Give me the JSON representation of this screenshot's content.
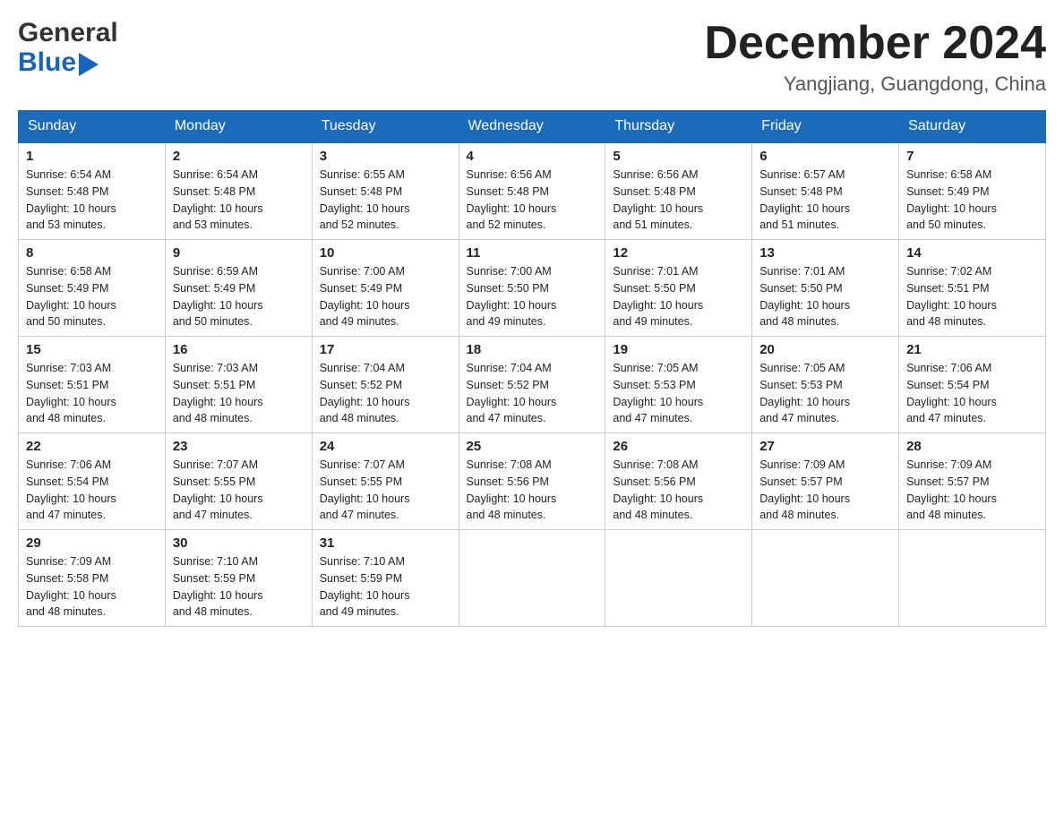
{
  "header": {
    "logo_general": "General",
    "logo_blue": "Blue",
    "month_title": "December 2024",
    "location": "Yangjiang, Guangdong, China"
  },
  "days_of_week": [
    "Sunday",
    "Monday",
    "Tuesday",
    "Wednesday",
    "Thursday",
    "Friday",
    "Saturday"
  ],
  "weeks": [
    [
      {
        "num": "1",
        "info": "Sunrise: 6:54 AM\nSunset: 5:48 PM\nDaylight: 10 hours\nand 53 minutes."
      },
      {
        "num": "2",
        "info": "Sunrise: 6:54 AM\nSunset: 5:48 PM\nDaylight: 10 hours\nand 53 minutes."
      },
      {
        "num": "3",
        "info": "Sunrise: 6:55 AM\nSunset: 5:48 PM\nDaylight: 10 hours\nand 52 minutes."
      },
      {
        "num": "4",
        "info": "Sunrise: 6:56 AM\nSunset: 5:48 PM\nDaylight: 10 hours\nand 52 minutes."
      },
      {
        "num": "5",
        "info": "Sunrise: 6:56 AM\nSunset: 5:48 PM\nDaylight: 10 hours\nand 51 minutes."
      },
      {
        "num": "6",
        "info": "Sunrise: 6:57 AM\nSunset: 5:48 PM\nDaylight: 10 hours\nand 51 minutes."
      },
      {
        "num": "7",
        "info": "Sunrise: 6:58 AM\nSunset: 5:49 PM\nDaylight: 10 hours\nand 50 minutes."
      }
    ],
    [
      {
        "num": "8",
        "info": "Sunrise: 6:58 AM\nSunset: 5:49 PM\nDaylight: 10 hours\nand 50 minutes."
      },
      {
        "num": "9",
        "info": "Sunrise: 6:59 AM\nSunset: 5:49 PM\nDaylight: 10 hours\nand 50 minutes."
      },
      {
        "num": "10",
        "info": "Sunrise: 7:00 AM\nSunset: 5:49 PM\nDaylight: 10 hours\nand 49 minutes."
      },
      {
        "num": "11",
        "info": "Sunrise: 7:00 AM\nSunset: 5:50 PM\nDaylight: 10 hours\nand 49 minutes."
      },
      {
        "num": "12",
        "info": "Sunrise: 7:01 AM\nSunset: 5:50 PM\nDaylight: 10 hours\nand 49 minutes."
      },
      {
        "num": "13",
        "info": "Sunrise: 7:01 AM\nSunset: 5:50 PM\nDaylight: 10 hours\nand 48 minutes."
      },
      {
        "num": "14",
        "info": "Sunrise: 7:02 AM\nSunset: 5:51 PM\nDaylight: 10 hours\nand 48 minutes."
      }
    ],
    [
      {
        "num": "15",
        "info": "Sunrise: 7:03 AM\nSunset: 5:51 PM\nDaylight: 10 hours\nand 48 minutes."
      },
      {
        "num": "16",
        "info": "Sunrise: 7:03 AM\nSunset: 5:51 PM\nDaylight: 10 hours\nand 48 minutes."
      },
      {
        "num": "17",
        "info": "Sunrise: 7:04 AM\nSunset: 5:52 PM\nDaylight: 10 hours\nand 48 minutes."
      },
      {
        "num": "18",
        "info": "Sunrise: 7:04 AM\nSunset: 5:52 PM\nDaylight: 10 hours\nand 47 minutes."
      },
      {
        "num": "19",
        "info": "Sunrise: 7:05 AM\nSunset: 5:53 PM\nDaylight: 10 hours\nand 47 minutes."
      },
      {
        "num": "20",
        "info": "Sunrise: 7:05 AM\nSunset: 5:53 PM\nDaylight: 10 hours\nand 47 minutes."
      },
      {
        "num": "21",
        "info": "Sunrise: 7:06 AM\nSunset: 5:54 PM\nDaylight: 10 hours\nand 47 minutes."
      }
    ],
    [
      {
        "num": "22",
        "info": "Sunrise: 7:06 AM\nSunset: 5:54 PM\nDaylight: 10 hours\nand 47 minutes."
      },
      {
        "num": "23",
        "info": "Sunrise: 7:07 AM\nSunset: 5:55 PM\nDaylight: 10 hours\nand 47 minutes."
      },
      {
        "num": "24",
        "info": "Sunrise: 7:07 AM\nSunset: 5:55 PM\nDaylight: 10 hours\nand 47 minutes."
      },
      {
        "num": "25",
        "info": "Sunrise: 7:08 AM\nSunset: 5:56 PM\nDaylight: 10 hours\nand 48 minutes."
      },
      {
        "num": "26",
        "info": "Sunrise: 7:08 AM\nSunset: 5:56 PM\nDaylight: 10 hours\nand 48 minutes."
      },
      {
        "num": "27",
        "info": "Sunrise: 7:09 AM\nSunset: 5:57 PM\nDaylight: 10 hours\nand 48 minutes."
      },
      {
        "num": "28",
        "info": "Sunrise: 7:09 AM\nSunset: 5:57 PM\nDaylight: 10 hours\nand 48 minutes."
      }
    ],
    [
      {
        "num": "29",
        "info": "Sunrise: 7:09 AM\nSunset: 5:58 PM\nDaylight: 10 hours\nand 48 minutes."
      },
      {
        "num": "30",
        "info": "Sunrise: 7:10 AM\nSunset: 5:59 PM\nDaylight: 10 hours\nand 48 minutes."
      },
      {
        "num": "31",
        "info": "Sunrise: 7:10 AM\nSunset: 5:59 PM\nDaylight: 10 hours\nand 49 minutes."
      },
      {
        "num": "",
        "info": ""
      },
      {
        "num": "",
        "info": ""
      },
      {
        "num": "",
        "info": ""
      },
      {
        "num": "",
        "info": ""
      }
    ]
  ]
}
